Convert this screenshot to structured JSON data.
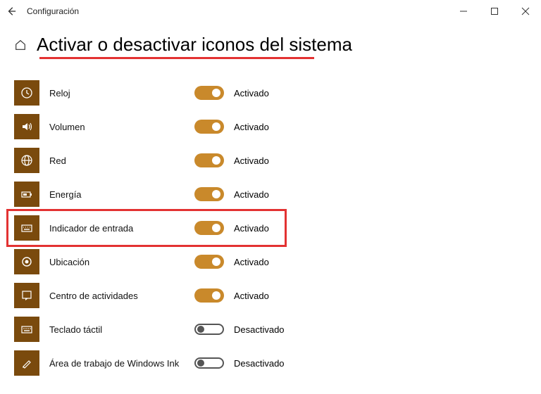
{
  "window": {
    "app_title": "Configuración"
  },
  "page": {
    "title": "Activar o desactivar iconos del sistema"
  },
  "state_labels": {
    "on": "Activado",
    "off": "Desactivado"
  },
  "colors": {
    "tile": "#7a4a0d",
    "toggle_on": "#c9892b",
    "annotation": "#e33232"
  },
  "settings": [
    {
      "id": "clock",
      "label": "Reloj",
      "on": true,
      "highlighted": false
    },
    {
      "id": "volume",
      "label": "Volumen",
      "on": true,
      "highlighted": false
    },
    {
      "id": "network",
      "label": "Red",
      "on": true,
      "highlighted": false
    },
    {
      "id": "power",
      "label": "Energía",
      "on": true,
      "highlighted": false
    },
    {
      "id": "input",
      "label": "Indicador de entrada",
      "on": true,
      "highlighted": true
    },
    {
      "id": "location",
      "label": "Ubicación",
      "on": true,
      "highlighted": false
    },
    {
      "id": "action-center",
      "label": "Centro de actividades",
      "on": true,
      "highlighted": false
    },
    {
      "id": "touch-kbd",
      "label": "Teclado táctil",
      "on": false,
      "highlighted": false
    },
    {
      "id": "ink",
      "label": "Área de trabajo de Windows Ink",
      "on": false,
      "highlighted": false
    }
  ]
}
